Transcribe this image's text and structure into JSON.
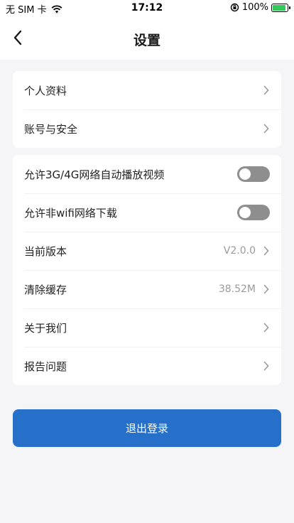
{
  "status_bar": {
    "carrier": "无 SIM 卡",
    "time": "17:12",
    "battery_percent": "100%"
  },
  "nav": {
    "title": "设置"
  },
  "group1": {
    "items": [
      {
        "label": "个人资料"
      },
      {
        "label": "账号与安全"
      }
    ]
  },
  "group2": {
    "items": [
      {
        "label": "允许3G/4G网络自动播放视频",
        "toggle": false
      },
      {
        "label": "允许非wifi网络下载",
        "toggle": false
      },
      {
        "label": "当前版本",
        "value": "V2.0.0"
      },
      {
        "label": "清除缓存",
        "value": "38.52M"
      },
      {
        "label": "关于我们"
      },
      {
        "label": "报告问题"
      }
    ]
  },
  "logout": {
    "label": "退出登录"
  },
  "colors": {
    "accent": "#2670c9",
    "background": "#f5f5f7",
    "toggle_off": "#8e8e8e",
    "battery": "#34c759"
  }
}
